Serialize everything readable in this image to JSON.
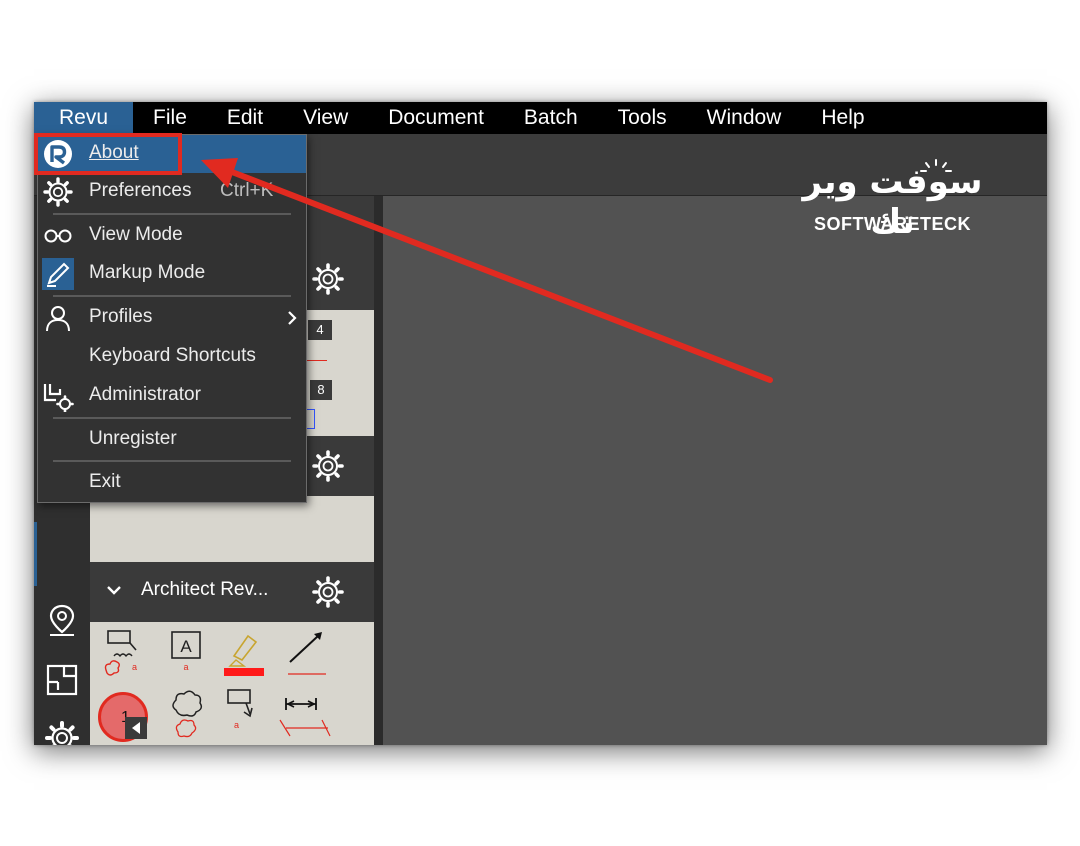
{
  "menubar": {
    "items": [
      {
        "label": "Revu",
        "active": true
      },
      {
        "label": "File"
      },
      {
        "label": "Edit"
      },
      {
        "label": "View"
      },
      {
        "label": "Document"
      },
      {
        "label": "Batch"
      },
      {
        "label": "Tools"
      },
      {
        "label": "Window"
      },
      {
        "label": "Help"
      }
    ]
  },
  "revu_menu": {
    "about": {
      "label": "About",
      "icon": "revu-logo-icon",
      "highlighted": true
    },
    "preferences": {
      "label": "Preferences",
      "shortcut": "Ctrl+K",
      "icon": "gear-icon"
    },
    "view_mode": {
      "label": "View Mode",
      "icon": "glasses-icon"
    },
    "markup_mode": {
      "label": "Markup Mode",
      "icon": "pencil-icon"
    },
    "profiles": {
      "label": "Profiles",
      "icon": "user-icon",
      "submenu_icon": "chevron-right-icon"
    },
    "keyboard_shortcuts": {
      "label": "Keyboard Shortcuts"
    },
    "administrator": {
      "label": "Administrator",
      "icon": "admin-gear-icon"
    },
    "unregister": {
      "label": "Unregister"
    },
    "exit": {
      "label": "Exit"
    }
  },
  "tool_panel": {
    "section_title": "Architect Rev...",
    "badge_1": "4",
    "badge_2": "8",
    "stamp_label": "A",
    "mini_label": "a",
    "count_label": "1"
  },
  "watermark": {
    "arabic": "سوفت وير تك",
    "latin": "SOFTWARETECK"
  },
  "colors": {
    "highlight": "#2a6194",
    "annotation_red": "#e12a20",
    "menubar_bg": "#000000",
    "canvas_bg": "#525252"
  }
}
